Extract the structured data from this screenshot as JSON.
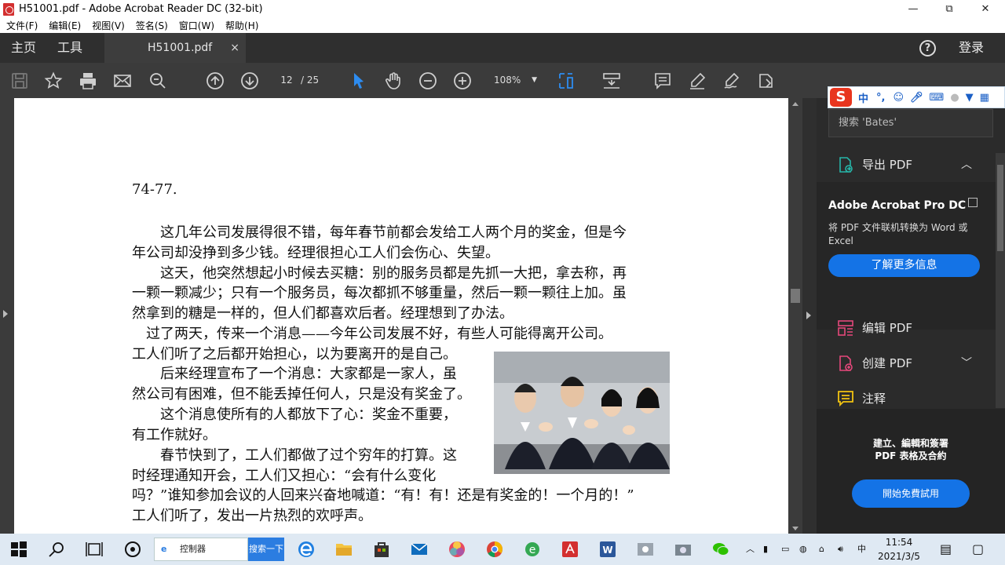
{
  "window": {
    "title": "H51001.pdf - Adobe Acrobat Reader DC (32-bit)",
    "minimize": "—",
    "restore": "⧉",
    "close": "✕"
  },
  "menu": [
    "文件(F)",
    "编辑(E)",
    "视图(V)",
    "签名(S)",
    "窗口(W)",
    "帮助(H)"
  ],
  "tabs": {
    "home": "主页",
    "tools": "工具",
    "document": "H51001.pdf",
    "close": "×",
    "help": "?",
    "login": "登录"
  },
  "toolbar": {
    "page_current": "12",
    "page_total": "/ 25",
    "zoom": "108%",
    "zoom_arrow": "▼"
  },
  "document": {
    "lines": [
      "74-77.",
      "　　这几年公司发展得很不错，每年春节前都会发给工人两个月的奖金，但是今",
      "年公司却没挣到多少钱。经理很担心工人们会伤心、失望。",
      "　　这天，他突然想起小时候去买糖：别的服务员都是先抓一大把，拿去称，再",
      "一颗一颗减少；只有一个服务员，每次都抓不够重量，然后一颗一颗往上加。虽",
      "然拿到的糖是一样的，但人们都喜欢后者。经理想到了办法。",
      "　过了两天，传来一个消息——今年公司发展不好，有些人可能得离开公司。",
      "工人们听了之后都开始担心，以为要离开的是自己。",
      "　　后来经理宣布了一个消息：大家都是一家人，虽",
      "然公司有困难，但不能丢掉任何人，只是没有奖金了。",
      "　　这个消息使所有的人都放下了心：奖金不重要，",
      "有工作就好。",
      "　　春节快到了，工人们都做了过个穷年的打算。这",
      "时经理通知开会，工人们又担心：“会有什么变化",
      "吗？”谁知参加会议的人回来兴奋地喊道：“有！有！还是有奖金的！一个月的！”",
      "工人们听了，发出一片热烈的欢呼声。"
    ]
  },
  "right_panel": {
    "search_placeholder": "搜索 'Bates'",
    "export_pdf": "导出 PDF",
    "promo_title": "Adobe Acrobat Pro DC",
    "promo_desc": "将 PDF 文件联机转换为 Word 或 Excel",
    "promo_button": "了解更多信息",
    "edit_pdf": "编辑 PDF",
    "create_pdf": "创建 PDF",
    "comment": "注释",
    "bottom_text_1": "建立、編輯和簽署",
    "bottom_text_2": "PDF 表格及合約",
    "bottom_button": "開始免費試用"
  },
  "ime": {
    "logo": "S",
    "lang": "中"
  },
  "taskbar": {
    "search_text": "控制器",
    "search_button": "搜索一下",
    "input_indicator": "中",
    "time": "11:54",
    "date": "2021/3/5"
  },
  "colors": {
    "accent_blue": "#1473e6",
    "acrobat_red": "#d32f2f",
    "panel_dark": "#2b2b2b",
    "toolbar_dark": "#3b3b3b",
    "tool_highlight": "#2d8cf0"
  }
}
